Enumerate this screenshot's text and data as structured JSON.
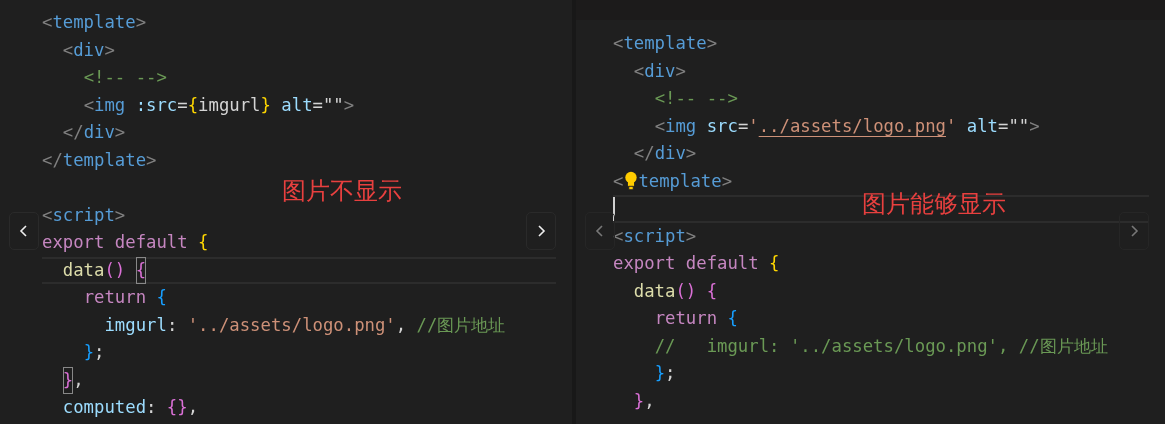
{
  "panels": [
    {
      "top_bar": false,
      "nav_dimmed": false,
      "lines": [
        {
          "tokens": [
            {
              "text": "<",
              "kind": "tagp"
            },
            {
              "text": "template",
              "kind": "tag"
            },
            {
              "text": ">",
              "kind": "tagp"
            }
          ]
        },
        {
          "tokens": [
            {
              "text": "  <",
              "kind": "tagp"
            },
            {
              "text": "div",
              "kind": "tag"
            },
            {
              "text": ">",
              "kind": "tagp"
            }
          ]
        },
        {
          "tokens": [
            {
              "text": "    <!-- -->",
              "kind": "comment"
            }
          ]
        },
        {
          "tokens": [
            {
              "text": "    <",
              "kind": "tagp"
            },
            {
              "text": "img",
              "kind": "tag"
            },
            {
              "text": " :src",
              "kind": "attr"
            },
            {
              "text": "=",
              "kind": "punct"
            },
            {
              "text": "{",
              "kind": "brace_yellow"
            },
            {
              "text": "imgurl",
              "kind": "plain"
            },
            {
              "text": "}",
              "kind": "brace_yellow"
            },
            {
              "text": " alt",
              "kind": "attr"
            },
            {
              "text": "=\"\"",
              "kind": "punct"
            },
            {
              "text": ">",
              "kind": "tagp"
            }
          ]
        },
        {
          "tokens": [
            {
              "text": "  </",
              "kind": "tagp"
            },
            {
              "text": "div",
              "kind": "tag"
            },
            {
              "text": ">",
              "kind": "tagp"
            }
          ]
        },
        {
          "tokens": [
            {
              "text": "</",
              "kind": "tagp"
            },
            {
              "text": "template",
              "kind": "tag"
            },
            {
              "text": ">",
              "kind": "tagp"
            }
          ]
        },
        {
          "annotation": "图片不显示"
        },
        {
          "tokens": [
            {
              "text": "<",
              "kind": "tagp"
            },
            {
              "text": "script",
              "kind": "tag"
            },
            {
              "text": ">",
              "kind": "tagp"
            }
          ]
        },
        {
          "tokens": [
            {
              "text": "export default ",
              "kind": "keyword"
            },
            {
              "text": "{",
              "kind": "brace_yellow"
            }
          ]
        },
        {
          "current": true,
          "tokens": [
            {
              "text": "  data",
              "kind": "func"
            },
            {
              "text": "() ",
              "kind": "brace_pink"
            },
            {
              "text": "{",
              "kind": "brace_pink",
              "matched": true
            }
          ]
        },
        {
          "tokens": [
            {
              "text": "    return ",
              "kind": "keyword"
            },
            {
              "text": "{",
              "kind": "brace_blue"
            }
          ]
        },
        {
          "tokens": [
            {
              "text": "      imgurl",
              "kind": "attr"
            },
            {
              "text": ": ",
              "kind": "punct"
            },
            {
              "text": "'../assets/logo.png'",
              "kind": "string"
            },
            {
              "text": ", ",
              "kind": "punct"
            },
            {
              "text": "//图片地址",
              "kind": "comment"
            }
          ]
        },
        {
          "tokens": [
            {
              "text": "    }",
              "kind": "brace_blue"
            },
            {
              "text": ";",
              "kind": "punct"
            }
          ]
        },
        {
          "tokens": [
            {
              "text": "  }",
              "kind": "brace_pink",
              "matched": true
            },
            {
              "text": ",",
              "kind": "punct"
            }
          ]
        },
        {
          "tokens": [
            {
              "text": "  computed",
              "kind": "attr"
            },
            {
              "text": ": ",
              "kind": "punct"
            },
            {
              "text": "{}",
              "kind": "brace_pink"
            },
            {
              "text": ",",
              "kind": "punct"
            }
          ]
        }
      ]
    },
    {
      "top_bar": true,
      "nav_dimmed": true,
      "lines": [
        {
          "tokens": [
            {
              "text": "<",
              "kind": "tagp"
            },
            {
              "text": "template",
              "kind": "tag"
            },
            {
              "text": ">",
              "kind": "tagp"
            }
          ]
        },
        {
          "tokens": [
            {
              "text": "  <",
              "kind": "tagp"
            },
            {
              "text": "div",
              "kind": "tag"
            },
            {
              "text": ">",
              "kind": "tagp"
            }
          ]
        },
        {
          "tokens": [
            {
              "text": "    <!-- -->",
              "kind": "comment"
            }
          ]
        },
        {
          "tokens": [
            {
              "text": "    <",
              "kind": "tagp"
            },
            {
              "text": "img",
              "kind": "tag"
            },
            {
              "text": " src",
              "kind": "attr"
            },
            {
              "text": "=",
              "kind": "punct"
            },
            {
              "text": "'",
              "kind": "string"
            },
            {
              "text": "../assets/logo.png",
              "kind": "string",
              "underlined": true
            },
            {
              "text": "'",
              "kind": "string"
            },
            {
              "text": " alt",
              "kind": "attr"
            },
            {
              "text": "=\"\"",
              "kind": "punct"
            },
            {
              "text": ">",
              "kind": "tagp"
            }
          ]
        },
        {
          "tokens": [
            {
              "text": "  </",
              "kind": "tagp"
            },
            {
              "text": "div",
              "kind": "tag"
            },
            {
              "text": ">",
              "kind": "tagp"
            }
          ]
        },
        {
          "lightbulb": true,
          "tokens": [
            {
              "text": "<",
              "kind": "tagp"
            },
            {
              "text": "template",
              "kind": "tag"
            },
            {
              "text": ">",
              "kind": "tagp"
            }
          ]
        },
        {
          "current": true,
          "caret": true,
          "annotation": "图片能够显示"
        },
        {
          "tokens": [
            {
              "text": "<",
              "kind": "tagp"
            },
            {
              "text": "script",
              "kind": "tag"
            },
            {
              "text": ">",
              "kind": "tagp"
            }
          ]
        },
        {
          "tokens": [
            {
              "text": "export default ",
              "kind": "keyword"
            },
            {
              "text": "{",
              "kind": "brace_yellow"
            }
          ]
        },
        {
          "tokens": [
            {
              "text": "  data",
              "kind": "func"
            },
            {
              "text": "() ",
              "kind": "brace_pink"
            },
            {
              "text": "{",
              "kind": "brace_pink"
            }
          ]
        },
        {
          "tokens": [
            {
              "text": "    return ",
              "kind": "keyword"
            },
            {
              "text": "{",
              "kind": "brace_blue"
            }
          ]
        },
        {
          "tokens": [
            {
              "text": "    //   imgurl: '../assets/logo.png', //图片地址",
              "kind": "comment"
            }
          ]
        },
        {
          "tokens": [
            {
              "text": "    }",
              "kind": "brace_blue"
            },
            {
              "text": ";",
              "kind": "punct"
            }
          ]
        },
        {
          "tokens": [
            {
              "text": "  }",
              "kind": "brace_pink"
            },
            {
              "text": ",",
              "kind": "punct"
            }
          ]
        }
      ]
    }
  ]
}
